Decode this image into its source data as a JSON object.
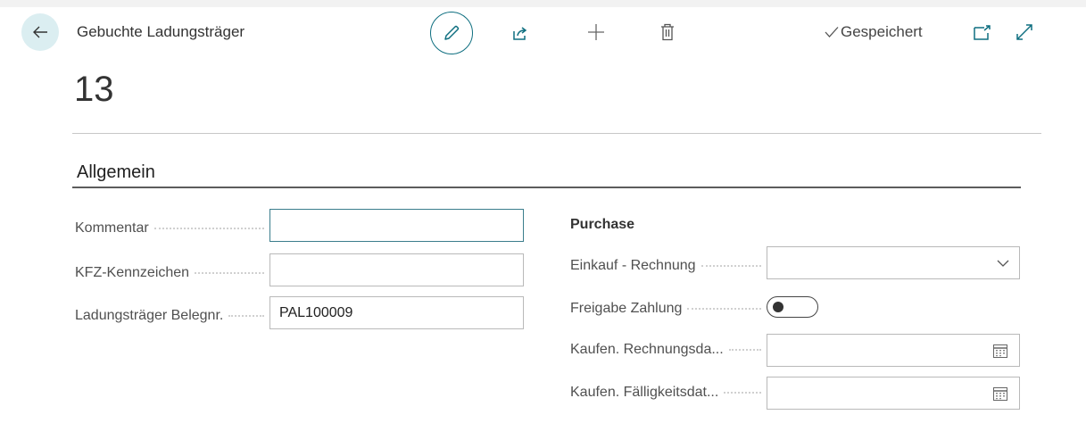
{
  "header": {
    "caption": "Gebuchte Ladungsträger",
    "record_no": "13",
    "saved_status": "Gespeichert"
  },
  "icons": {
    "back": "arrow-left-icon",
    "edit": "pencil-icon",
    "share": "share-icon",
    "new": "plus-icon",
    "delete": "trash-icon",
    "saved": "checkmark-icon",
    "popout": "open-new-window-icon",
    "expand": "expand-icon",
    "dropdown": "chevron-down-icon",
    "date": "calendar-icon"
  },
  "colors": {
    "accent": "#0f6f80",
    "back_button_bg": "#dbeef1"
  },
  "section": {
    "title": "Allgemein"
  },
  "left_fields": {
    "kommentar": {
      "label": "Kommentar",
      "value": ""
    },
    "kfz": {
      "label": "KFZ-Kennzeichen",
      "value": ""
    },
    "belegnr": {
      "label": "Ladungsträger Belegnr.",
      "value": "PAL100009"
    }
  },
  "right_group": {
    "title": "Purchase",
    "einkauf": {
      "label": "Einkauf - Rechnung",
      "value": ""
    },
    "freigabe": {
      "label": "Freigabe Zahlung",
      "checked": false
    },
    "rechnungsdatum": {
      "label": "Kaufen. Rechnungsda...",
      "value": ""
    },
    "faelligkeit": {
      "label": "Kaufen. Fälligkeitsdat...",
      "value": ""
    }
  }
}
